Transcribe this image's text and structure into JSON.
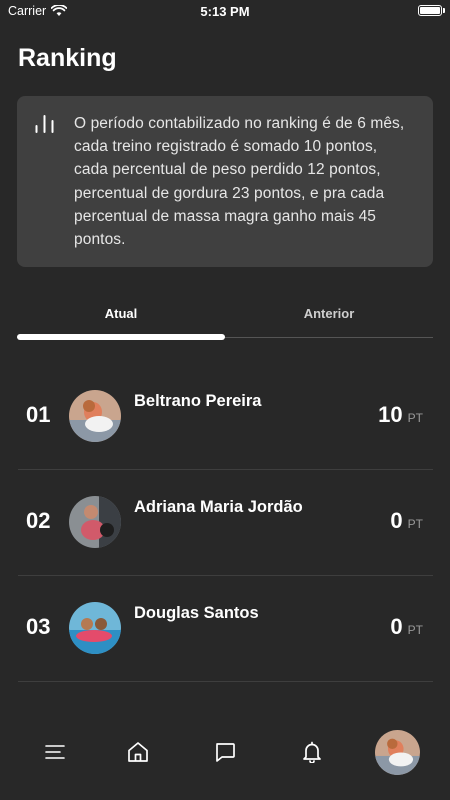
{
  "status_bar": {
    "carrier": "Carrier",
    "time": "5:13 PM",
    "battery_level": 1.0
  },
  "page": {
    "title": "Ranking"
  },
  "info": {
    "icon": "bar-chart-icon",
    "text": "O período contabilizado no ranking é de 6 mês, cada treino registrado é somado 10 pontos, cada percentual de peso perdido 12 pontos, percentual de gordura 23 pontos, e pra cada percentual de massa magra ganho mais 45 pontos."
  },
  "tabs": [
    {
      "label": "Atual",
      "active": true
    },
    {
      "label": "Anterior",
      "active": false
    }
  ],
  "ranking": [
    {
      "position": "01",
      "name": "Beltrano Pereira",
      "score": "10",
      "unit": "PT"
    },
    {
      "position": "02",
      "name": "Adriana Maria Jordão",
      "score": "0",
      "unit": "PT"
    },
    {
      "position": "03",
      "name": "Douglas Santos",
      "score": "0",
      "unit": "PT"
    }
  ],
  "bottom_nav": {
    "items": [
      "menu-icon",
      "home-icon",
      "chat-icon",
      "bell-icon",
      "profile-avatar"
    ]
  },
  "colors": {
    "background": "#282828",
    "card": "#404040",
    "text": "#ffffff",
    "muted": "#9a9a9a",
    "divider": "#3e3e3e"
  }
}
